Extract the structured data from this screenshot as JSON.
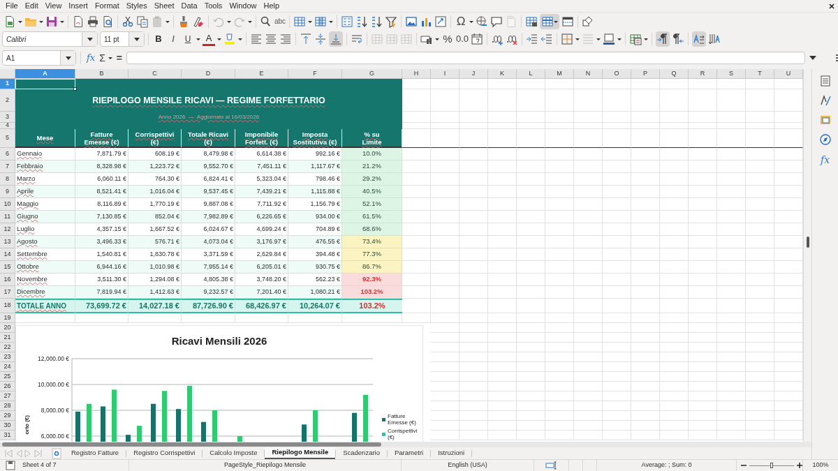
{
  "menu": [
    "File",
    "Edit",
    "View",
    "Insert",
    "Format",
    "Styles",
    "Sheet",
    "Data",
    "Tools",
    "Window",
    "Help"
  ],
  "glyphs": {
    "spelling": "abc",
    "special_character": "Ω",
    "bold": "B",
    "italic": "I",
    "underline": "U",
    "font_color": "A",
    "percent": "%",
    "number_format": "0.0",
    "function": "fx",
    "sum": "Σ",
    "equals": "=",
    "sidebar_function": "fx"
  },
  "font_name": "Calibri",
  "font_size": "11 pt",
  "name_box": "A1",
  "columns": [
    {
      "label": "A",
      "selected": true
    },
    {
      "label": "B",
      "selected": false
    },
    {
      "label": "C",
      "selected": false
    },
    {
      "label": "D",
      "selected": false
    },
    {
      "label": "E",
      "selected": false
    },
    {
      "label": "F",
      "selected": false
    },
    {
      "label": "G",
      "selected": false
    },
    {
      "label": "H",
      "selected": false
    },
    {
      "label": "I",
      "selected": false
    },
    {
      "label": "J",
      "selected": false
    },
    {
      "label": "K",
      "selected": false
    },
    {
      "label": "L",
      "selected": false
    },
    {
      "label": "M",
      "selected": false
    },
    {
      "label": "N",
      "selected": false
    },
    {
      "label": "O",
      "selected": false
    },
    {
      "label": "P",
      "selected": false
    },
    {
      "label": "Q",
      "selected": false
    },
    {
      "label": "R",
      "selected": false
    },
    {
      "label": "S",
      "selected": false
    },
    {
      "label": "T",
      "selected": false
    },
    {
      "label": "U",
      "selected": false
    }
  ],
  "row_headers": [
    {
      "label": "1",
      "selected": true
    },
    {
      "label": "2",
      "selected": false
    },
    {
      "label": "3",
      "selected": false
    },
    {
      "label": "4",
      "selected": false
    },
    {
      "label": "5",
      "selected": false
    },
    {
      "label": "6",
      "selected": false
    },
    {
      "label": "7",
      "selected": false
    },
    {
      "label": "8",
      "selected": false
    },
    {
      "label": "9",
      "selected": false
    },
    {
      "label": "10",
      "selected": false
    },
    {
      "label": "11",
      "selected": false
    },
    {
      "label": "12",
      "selected": false
    },
    {
      "label": "13",
      "selected": false
    },
    {
      "label": "14",
      "selected": false
    },
    {
      "label": "15",
      "selected": false
    },
    {
      "label": "16",
      "selected": false
    },
    {
      "label": "17",
      "selected": false
    },
    {
      "label": "18",
      "selected": false
    },
    {
      "label": "19",
      "selected": false
    },
    {
      "label": "20",
      "selected": false
    },
    {
      "label": "21",
      "selected": false
    },
    {
      "label": "22",
      "selected": false
    },
    {
      "label": "23",
      "selected": false
    },
    {
      "label": "24",
      "selected": false
    },
    {
      "label": "25",
      "selected": false
    },
    {
      "label": "26",
      "selected": false
    },
    {
      "label": "27",
      "selected": false
    },
    {
      "label": "28",
      "selected": false
    },
    {
      "label": "29",
      "selected": false
    },
    {
      "label": "30",
      "selected": false
    },
    {
      "label": "31",
      "selected": false
    }
  ],
  "sheet": {
    "title": "RIEPILOGO MENSILE RICAVI — REGIME FORFETTARIO",
    "subtitle": "Anno 2026  —  Aggiornato al 16/03/2026",
    "headers": [
      "Mese",
      "Fatture\nEmesse (€)",
      "Corrispettivi\n(€)",
      "Totale Ricavi\n(€)",
      "Imponibile\nForfett. (€)",
      "Imposta\nSostitutiva (€)",
      "% su\nLimite"
    ],
    "rows": [
      {
        "month": "Gennaio",
        "values": [
          "7,871.79 €",
          "608.19 €",
          "8,479.98 €",
          "6,614.38 €",
          "992.16 €"
        ],
        "percent": "10.0%",
        "color": "#dcf5e4",
        "over_limit": false
      },
      {
        "month": "Febbraio",
        "values": [
          "8,328.98 €",
          "1,223.72 €",
          "9,552.70 €",
          "7,451.11 €",
          "1,117.67 €"
        ],
        "percent": "21.2%",
        "color": "#dcf5e4",
        "over_limit": false
      },
      {
        "month": "Marzo",
        "values": [
          "6,060.11 €",
          "764.30 €",
          "6,824.41 €",
          "5,323.04 €",
          "798.46 €"
        ],
        "percent": "29.2%",
        "color": "#dcf5e4",
        "over_limit": false
      },
      {
        "month": "Aprile",
        "values": [
          "8,521.41 €",
          "1,016.04 €",
          "9,537.45 €",
          "7,439.21 €",
          "1,115.88 €"
        ],
        "percent": "40.5%",
        "color": "#dcf5e4",
        "over_limit": false
      },
      {
        "month": "Maggio",
        "values": [
          "8,116.89 €",
          "1,770.19 €",
          "9,887.08 €",
          "7,711.92 €",
          "1,156.79 €"
        ],
        "percent": "52.1%",
        "color": "#dcf5e4",
        "over_limit": false
      },
      {
        "month": "Giugno",
        "values": [
          "7,130.85 €",
          "852.04 €",
          "7,982.89 €",
          "6,226.65 €",
          "934.00 €"
        ],
        "percent": "61.5%",
        "color": "#dcf5e4",
        "over_limit": false
      },
      {
        "month": "Luglio",
        "values": [
          "4,357.15 €",
          "1,667.52 €",
          "6,024.67 €",
          "4,699.24 €",
          "704.89 €"
        ],
        "percent": "68.6%",
        "color": "#dcf5e4",
        "over_limit": false
      },
      {
        "month": "Agosto",
        "values": [
          "3,496.33 €",
          "576.71 €",
          "4,073.04 €",
          "3,176.97 €",
          "476.55 €"
        ],
        "percent": "73.4%",
        "color": "#fcf3c2",
        "over_limit": false
      },
      {
        "month": "Settembre",
        "values": [
          "1,540.81 €",
          "1,830.78 €",
          "3,371.59 €",
          "2,629.84 €",
          "394.48 €"
        ],
        "percent": "77.3%",
        "color": "#fcf3c2",
        "over_limit": false
      },
      {
        "month": "Ottobre",
        "values": [
          "6,944.16 €",
          "1,010.98 €",
          "7,955.14 €",
          "6,205.01 €",
          "930.75 €"
        ],
        "percent": "86.7%",
        "color": "#fcf3c2",
        "over_limit": false
      },
      {
        "month": "Novembre",
        "values": [
          "3,511.30 €",
          "1,294.08 €",
          "4,805.38 €",
          "3,748.20 €",
          "562.23 €"
        ],
        "percent": "92.3%",
        "color": "#fbdcdc",
        "over_limit": true
      },
      {
        "month": "Dicembre",
        "values": [
          "7,819.94 €",
          "1,412.63 €",
          "9,232.57 €",
          "7,201.40 €",
          "1,080.21 €"
        ],
        "percent": "103.2%",
        "color": "#fbdcdc",
        "over_limit": true
      }
    ],
    "total": {
      "label": "TOTALE ANNO",
      "values": [
        "73,699.72 €",
        "14,027.18 €",
        "87,726.90 €",
        "68,426.97 €",
        "10,264.07 €"
      ],
      "percent": "103.2%",
      "over_limit": true
    }
  },
  "chart": {
    "chart_data": {
      "type": "bar",
      "title": "Ricavi Mensili 2026",
      "ylabel": "orto (€)",
      "stacked": false,
      "ylim": [
        0,
        12000
      ],
      "grid": true,
      "legend": true,
      "yticks": [
        {
          "value": 6000,
          "label": "6,000.00 €"
        },
        {
          "value": 8000,
          "label": "8,000.00 €"
        },
        {
          "value": 10000,
          "label": "10,000.00 €"
        },
        {
          "value": 12000,
          "label": "12,000.00 €"
        }
      ],
      "series": [
        {
          "name": "Fatture Emesse (€)",
          "color": "#17736a",
          "values": [
            7900,
            8300,
            6100,
            8500,
            8100,
            7100,
            null,
            null,
            null,
            6900,
            null,
            7800
          ]
        },
        {
          "name": "Corrispettivi (€)",
          "color": "#2ac3b3",
          "values": [
            null,
            null,
            null,
            null,
            null,
            null,
            null,
            null,
            null,
            null,
            null,
            null
          ]
        },
        {
          "color": "#2ecc71",
          "values": [
            8500,
            9600,
            6800,
            9500,
            9900,
            8000,
            6000,
            null,
            null,
            8000,
            null,
            9200
          ]
        }
      ]
    }
  },
  "sheet_tabs": [
    {
      "label": "Registro Fatture",
      "selected": false
    },
    {
      "label": "Registro Corrispettivi",
      "selected": false
    },
    {
      "label": "Calcolo Imposte",
      "selected": false
    },
    {
      "label": "Riepilogo Mensile",
      "selected": true
    },
    {
      "label": "Scadenzario",
      "selected": false
    },
    {
      "label": "Parametri",
      "selected": false
    },
    {
      "label": "Istruzioni",
      "selected": false
    }
  ],
  "status_bar": {
    "sheet_position": "Sheet 4 of 7",
    "page_style": "PageStyle_Riepilogo Mensile",
    "language": "English (USA)",
    "selection_summary": "Average: ; Sum: 0",
    "zoom": "100%",
    "zoom_slider": {
      "level": 0.5
    }
  }
}
